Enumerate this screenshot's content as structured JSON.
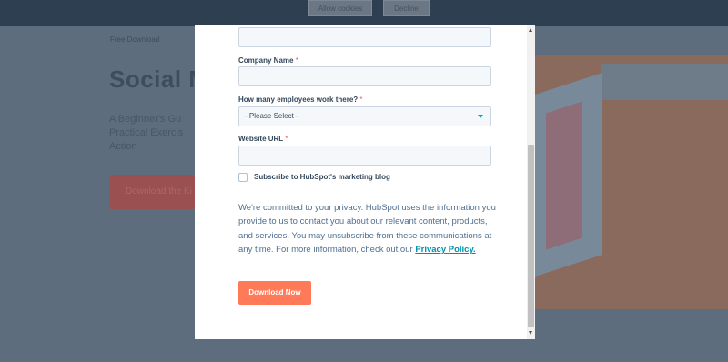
{
  "background": {
    "cookie_banner": {
      "allow_label": "Allow cookies",
      "decline_label": "Decline"
    },
    "breadcrumb": "Free Download",
    "title": "Social M",
    "description": "A Beginner's Gu Practical Exercis Action",
    "cta_label": "Download the Ki"
  },
  "form": {
    "company_label": "Company Name",
    "employees_label": "How many employees work there?",
    "employees_selected": "- Please Select -",
    "website_label": "Website URL",
    "required_marker": "*",
    "subscribe_label": "Subscribe to HubSpot's marketing blog",
    "subscribe_checked": false,
    "privacy_text": "We're committed to your privacy. HubSpot uses the information you provide to us to contact you about our relevant content, products, and services. You may unsubscribe from these communications at any time. For more information, check out our",
    "privacy_link": "Privacy Policy.",
    "submit_label": "Download Now"
  },
  "colors": {
    "overlay": "#5d6d7d",
    "cookie_bar": "#2e3f51",
    "submit_button": "#ff7a59",
    "link": "#0091ae",
    "input_bg": "#f5f8fa",
    "input_border": "#cbd6e2",
    "label": "#33475b",
    "body_text": "#516f90"
  },
  "icons": {
    "select_arrow": "caret-down-icon",
    "scroll_up": "arrow-up-icon",
    "scroll_down": "arrow-down-icon"
  }
}
